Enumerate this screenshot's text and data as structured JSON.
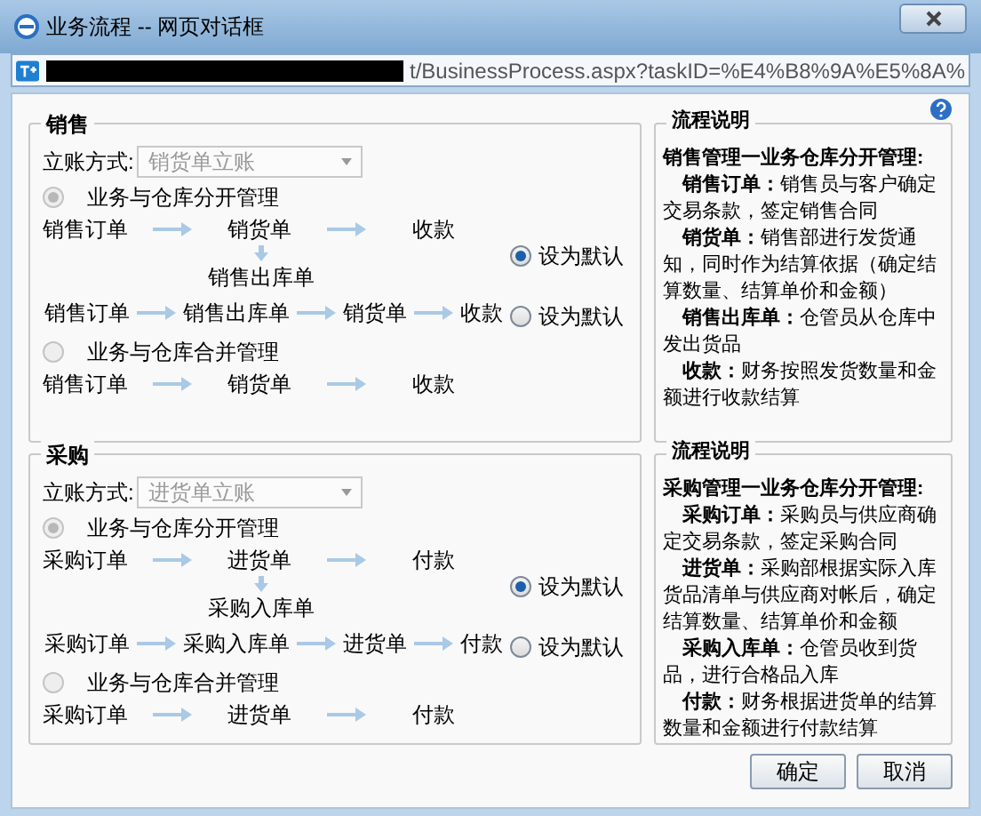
{
  "window": {
    "title": "业务流程 -- 网页对话框"
  },
  "address_bar": {
    "url": "t/BusinessProcess.aspx?taskID=%E4%B8%9A%E5%8A%"
  },
  "sections": [
    {
      "legend": "销售",
      "account_label": "立账方式:",
      "account_value": "销货单立账",
      "options": [
        {
          "label": "业务与仓库分开管理",
          "selected": true,
          "flows": [
            {
              "steps": [
                "销售订单",
                "销货单",
                "收款"
              ],
              "branch": "销售出库单",
              "default": {
                "label": "设为默认",
                "selected": true
              }
            },
            {
              "steps": [
                "销售订单",
                "销售出库单",
                "销货单",
                "收款"
              ],
              "default": {
                "label": "设为默认",
                "selected": false
              }
            }
          ]
        },
        {
          "label": "业务与仓库合并管理",
          "selected": false,
          "flows": [
            {
              "steps": [
                "销售订单",
                "销货单",
                "收款"
              ]
            }
          ]
        }
      ],
      "description": {
        "title": "流程说明",
        "heading": "销售管理一业务仓库分开管理:",
        "items": [
          "**销售订单：**销售员与客户确定交易条款，签定销售合同",
          "**销货单：**销售部进行发货通知，同时作为结算依据（确定结算数量、结算单价和金额）",
          "**销售出库单：**仓管员从仓库中发出货品",
          "**收款：**财务按照发货数量和金额进行收款结算"
        ]
      }
    },
    {
      "legend": "采购",
      "account_label": "立账方式:",
      "account_value": "进货单立账",
      "options": [
        {
          "label": "业务与仓库分开管理",
          "selected": true,
          "flows": [
            {
              "steps": [
                "采购订单",
                "进货单",
                "付款"
              ],
              "branch": "采购入库单",
              "default": {
                "label": "设为默认",
                "selected": true
              }
            },
            {
              "steps": [
                "采购订单",
                "采购入库单",
                "进货单",
                "付款"
              ],
              "default": {
                "label": "设为默认",
                "selected": false
              }
            }
          ]
        },
        {
          "label": "业务与仓库合并管理",
          "selected": false,
          "flows": [
            {
              "steps": [
                "采购订单",
                "进货单",
                "付款"
              ]
            }
          ]
        }
      ],
      "description": {
        "title": "流程说明",
        "heading": "采购管理一业务仓库分开管理:",
        "items": [
          "**采购订单：**采购员与供应商确定交易条款，签定采购合同",
          "**进货单：**采购部根据实际入库货品清单与供应商对帐后，确定结算数量、结算单价和金额",
          "**采购入库单：**仓管员收到货品，进行合格品入库",
          "**付款：**财务根据进货单的结算数量和金额进行付款结算"
        ]
      }
    }
  ],
  "buttons": [
    "确定",
    "取消"
  ]
}
